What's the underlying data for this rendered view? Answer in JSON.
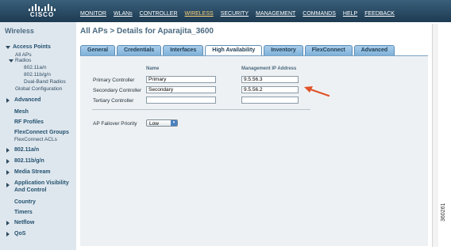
{
  "brand": {
    "name": "CISCO"
  },
  "menu": [
    {
      "label": "MONITOR"
    },
    {
      "label": "WLANs"
    },
    {
      "label": "CONTROLLER"
    },
    {
      "label": "WIRELESS"
    },
    {
      "label": "SECURITY"
    },
    {
      "label": "MANAGEMENT"
    },
    {
      "label": "COMMANDS"
    },
    {
      "label": "HELP"
    },
    {
      "label": "FEEDBACK"
    }
  ],
  "sidebar": {
    "title": "Wireless",
    "items": [
      {
        "label": "Access Points"
      },
      {
        "label": "All APs"
      },
      {
        "label": "Radios"
      },
      {
        "label": "802.11a/n"
      },
      {
        "label": "802.11b/g/n"
      },
      {
        "label": "Dual-Band Radios"
      },
      {
        "label": "Global Configuration"
      },
      {
        "label": "Advanced"
      },
      {
        "label": "Mesh"
      },
      {
        "label": "RF Profiles"
      },
      {
        "label": "FlexConnect Groups"
      },
      {
        "label": "FlexConnect ACLs"
      },
      {
        "label": "802.11a/n"
      },
      {
        "label": "802.11b/g/n"
      },
      {
        "label": "Media Stream"
      },
      {
        "label": "Application Visibility"
      },
      {
        "label": "And Control"
      },
      {
        "label": "Country"
      },
      {
        "label": "Timers"
      },
      {
        "label": "Netflow"
      },
      {
        "label": "QoS"
      }
    ]
  },
  "main": {
    "title": "All APs > Details for Aparajita_3600",
    "tabs": [
      {
        "label": "General"
      },
      {
        "label": "Credentials"
      },
      {
        "label": "Interfaces"
      },
      {
        "label": "High Availability"
      },
      {
        "label": "Inventory"
      },
      {
        "label": "FlexConnect"
      },
      {
        "label": "Advanced"
      }
    ],
    "columns": {
      "name": "Name",
      "ip": "Management IP Address"
    },
    "rows": [
      {
        "label": "Primary Controller",
        "name": "Primary",
        "ip": "9.5.56.3"
      },
      {
        "label": "Secondary Controller",
        "name": "Secondary",
        "ip": "9.5.56.2"
      },
      {
        "label": "Tertiary Controller",
        "name": "",
        "ip": ""
      }
    ],
    "failover": {
      "label": "AP Failover Priority",
      "value": "Low"
    }
  },
  "watermark": "360261",
  "colors": {
    "header": "#1e3b52",
    "active_menu": "#ffd27a",
    "arrow": "#e0522a"
  }
}
